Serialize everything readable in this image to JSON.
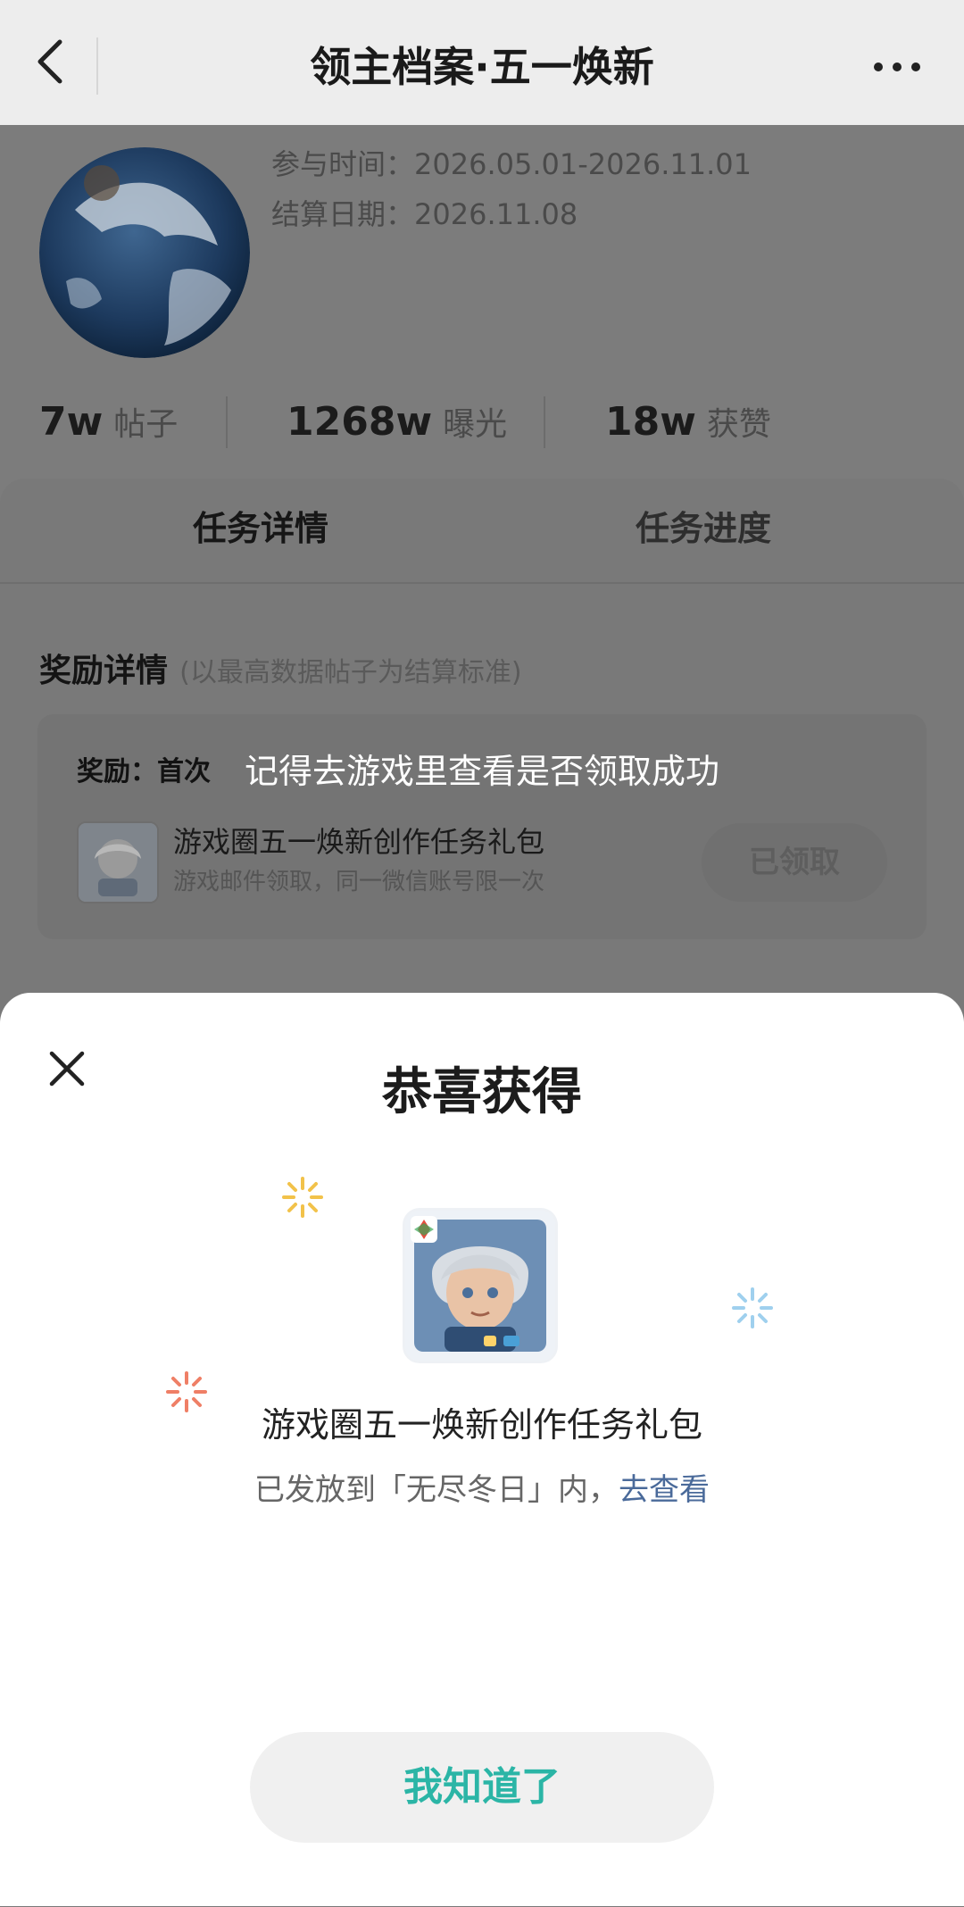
{
  "nav": {
    "title": "领主档案·五一焕新"
  },
  "profile": {
    "participation_time": "参与时间：2026.05.01-2026.11.01",
    "settlement_date": "结算日期：2026.11.08"
  },
  "stats": [
    {
      "value": "7w",
      "label": "帖子"
    },
    {
      "value": "1268w",
      "label": "曝光"
    },
    {
      "value": "18w",
      "label": "获赞"
    }
  ],
  "tabs": [
    {
      "label": "任务详情",
      "active": true
    },
    {
      "label": "任务进度",
      "active": false
    }
  ],
  "reward": {
    "title": "奖励详情",
    "note": "(以最高数据帖子为结算标准)",
    "label": "奖励：首次",
    "item_name": "游戏圈五一焕新创作任务礼包",
    "item_desc": "游戏邮件领取，同一微信账号限一次",
    "claim_button": "已领取"
  },
  "toast": {
    "message": "记得去游戏里查看是否领取成功"
  },
  "modal": {
    "title": "恭喜获得",
    "gift_name": "游戏圈五一焕新创作任务礼包",
    "sent_text": "已发放到「无尽冬日」内，",
    "link_text": "去查看",
    "confirm_button": "我知道了"
  },
  "colors": {
    "accent_teal": "#2bb5a6",
    "link_blue": "#4a6a9a",
    "spark_yellow": "#f2c24a",
    "spark_blue": "#9fd0ee",
    "spark_red": "#ef7f66"
  }
}
